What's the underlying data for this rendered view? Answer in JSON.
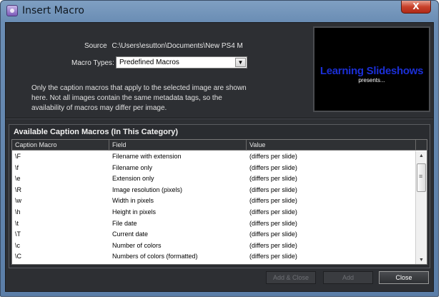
{
  "window": {
    "title": "Insert Macro",
    "close_glyph": "X"
  },
  "source": {
    "label": "Source",
    "path": "C:\\Users\\esutton\\Documents\\New PS4 M"
  },
  "macro_types": {
    "label": "Macro Types",
    "selected": "Predefined Macros"
  },
  "info_text": "Only the caption macros that apply to the selected image are shown here. Not all images contain the same metadata tags, so the availability of macros may differ per image.",
  "preview": {
    "title": "Learning Slideshows",
    "subtitle": "presents..."
  },
  "panel": {
    "title": "Available Caption Macros (In This Category)",
    "columns": [
      "Caption Macro",
      "Field",
      "Value"
    ],
    "rows": [
      [
        "\\F",
        "Filename with extension",
        "(differs per slide)"
      ],
      [
        "\\f",
        "Filename only",
        "(differs per slide)"
      ],
      [
        "\\e",
        "Extension only",
        "(differs per slide)"
      ],
      [
        "\\R",
        "Image resolution (pixels)",
        "(differs per slide)"
      ],
      [
        "\\w",
        "Width in pixels",
        "(differs per slide)"
      ],
      [
        "\\h",
        "Height in pixels",
        "(differs per slide)"
      ],
      [
        "\\t",
        "File date",
        "(differs per slide)"
      ],
      [
        "\\T",
        "Current date",
        "(differs per slide)"
      ],
      [
        "\\c",
        "Number of colors",
        "(differs per slide)"
      ],
      [
        "\\C",
        "Numbers of colors (formatted)",
        "(differs per slide)"
      ]
    ]
  },
  "buttons": {
    "add_close": "Add & Close",
    "add": "Add",
    "close": "Close"
  },
  "colors": {
    "preview_title": "#1b2fd6",
    "client_bg": "#2d2f33"
  }
}
